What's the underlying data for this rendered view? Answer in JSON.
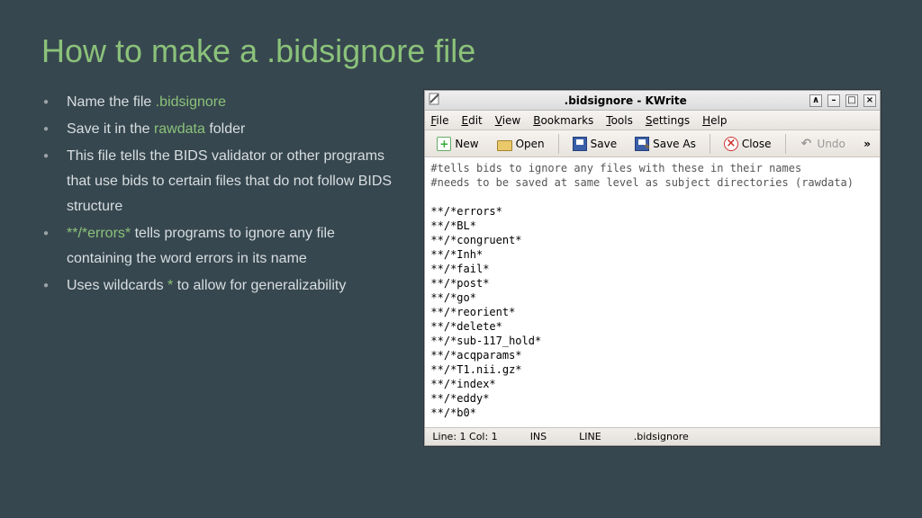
{
  "title": "How to make a .bidsignore file",
  "bullets": {
    "b1_pre": "Name the file ",
    "b1_hl": ".bidsignore",
    "b2_pre": "Save it in the ",
    "b2_hl": "rawdata",
    "b2_post": " folder",
    "b3": "This file tells the BIDS validator or other programs that use bids to certain files that do not follow BIDS structure",
    "b4_hl": "**/*errors*",
    "b4_post": " tells programs to ignore any file containing the word errors in its name",
    "b5_pre": "Uses wildcards ",
    "b5_hl": "*",
    "b5_post": " to allow for generalizability"
  },
  "window": {
    "title": ".bidsignore - KWrite",
    "menubar": {
      "file": "File",
      "edit": "Edit",
      "view": "View",
      "bookmarks": "Bookmarks",
      "tools": "Tools",
      "settings": "Settings",
      "help": "Help"
    },
    "toolbar": {
      "new": "New",
      "open": "Open",
      "save": "Save",
      "saveas": "Save As",
      "close": "Close",
      "undo": "Undo",
      "overflow": "»"
    },
    "editor": {
      "comment1": "#tells bids to ignore any files with these in their names",
      "comment2": "#needs to be saved at same level as subject directories (rawdata)",
      "patterns": [
        "**/*errors*",
        "**/*BL*",
        "**/*congruent*",
        "**/*Inh*",
        "**/*fail*",
        "**/*post*",
        "**/*go*",
        "**/*reorient*",
        "**/*delete*",
        "**/*sub-117_hold*",
        "**/*acqparams*",
        "**/*T1.nii.gz*",
        "**/*index*",
        "**/*eddy*",
        "**/*b0*"
      ]
    },
    "status": {
      "pos": "Line: 1 Col: 1",
      "mode": "INS",
      "linemode": "LINE",
      "filename": ".bidsignore"
    }
  }
}
